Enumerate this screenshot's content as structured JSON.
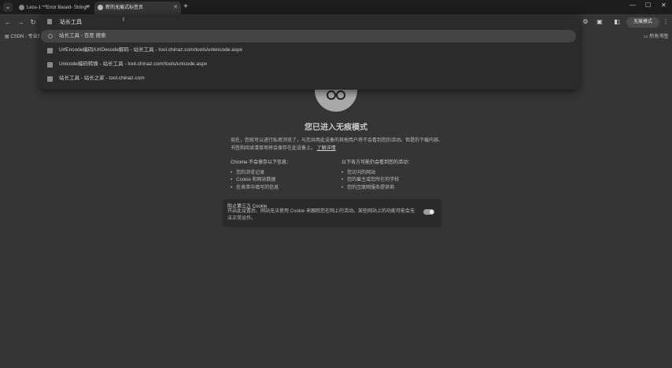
{
  "tabs": [
    {
      "title": "Less-1 **Error Based- String**",
      "active": false
    },
    {
      "title": "新的无痕式标签页",
      "active": true
    }
  ],
  "new_tab_label": "+",
  "window_controls": [
    "—",
    "☐",
    "✕"
  ],
  "nav": {
    "back": "←",
    "forward": "→",
    "reload": "↻"
  },
  "omnibox": {
    "input": "站长工具",
    "suggestions": [
      {
        "icon": "search-icon",
        "text": "站长工具 - 百度 搜索",
        "selected": true
      },
      {
        "icon": "page-icon",
        "text": "UrlEncode编码/UrlDecode解码 - 站长工具 - tool.chinaz.com/tools/urlencode.aspx",
        "selected": false
      },
      {
        "icon": "page-icon",
        "text": "Unicode编码转换 - 站长工具 - tool.chinaz.com/tools/unicode.aspx",
        "selected": false
      },
      {
        "icon": "page-icon",
        "text": "站长工具 - 站长之家 - tool.chinaz.com",
        "selected": false
      }
    ]
  },
  "toolbar": {
    "incognito_label": "无痕模式"
  },
  "bookmarks": {
    "items": [
      "CSDN - 专业开..."
    ],
    "all_bookmarks": "所有书签"
  },
  "incognito_page": {
    "title": "您已进入无痕模式",
    "description": "现在，您就可以进行私密浏览了，与您共用此设备的其他用户将不会看到您的活动。但是的下载内容、书签和阅读清单项将会保存在此设备上。",
    "learn_more": "了解详情",
    "not_saved_heading": "Chrome 不会保存以下信息：",
    "not_saved_items": [
      "您的浏览记录",
      "Cookie 和网站数据",
      "在表单中填写的信息"
    ],
    "visible_heading": "以下各方可能仍会看到您的活动：",
    "visible_items": [
      "您访问的网站",
      "您的雇主或您所在的学校",
      "您的互联网服务提供商"
    ],
    "cookie_title": "阻止第三方 Cookie",
    "cookie_desc": "开启此设置后，网站无法使用 Cookie 来跟踪您在网上的活动。某些网站上的功能可能会无法正常运作。",
    "cookie_toggle_on": true
  }
}
